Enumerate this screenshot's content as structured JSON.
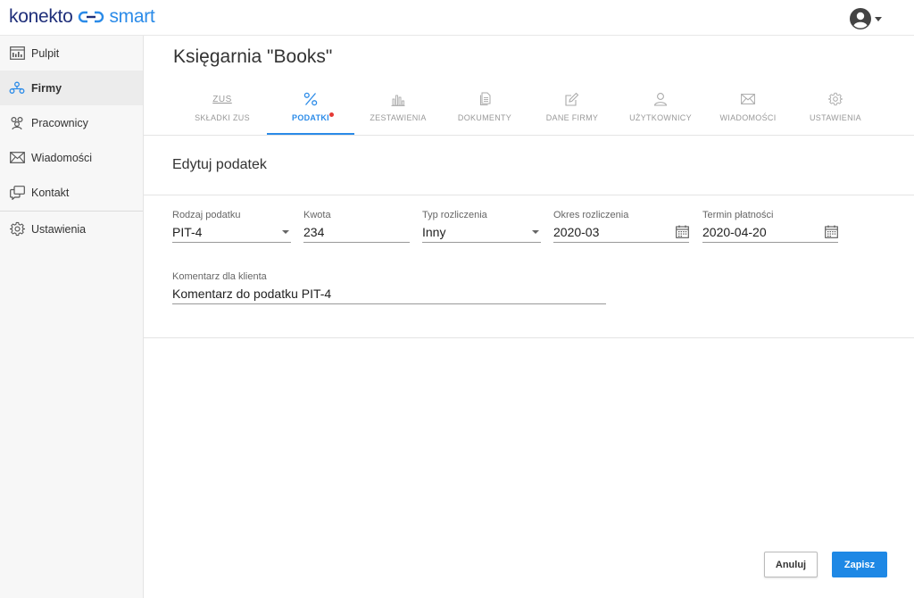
{
  "header": {
    "logo_left": "konekto",
    "logo_right": "smart"
  },
  "sidebar": {
    "items": [
      {
        "label": "Pulpit",
        "icon": "dashboard-icon"
      },
      {
        "label": "Firmy",
        "icon": "companies-icon",
        "active": true
      },
      {
        "label": "Pracownicy",
        "icon": "employees-icon"
      },
      {
        "label": "Wiadomości",
        "icon": "mail-icon"
      },
      {
        "label": "Kontakt",
        "icon": "contact-icon"
      },
      {
        "label": "Ustawienia",
        "icon": "gear-icon"
      }
    ]
  },
  "company": {
    "title": "Księgarnia \"Books\""
  },
  "tabs": [
    {
      "label": "SKŁADKI ZUS",
      "icon": "zus-icon"
    },
    {
      "label": "PODATKI",
      "icon": "percent-icon",
      "active": true,
      "badge": true
    },
    {
      "label": "ZESTAWIENIA",
      "icon": "bar-chart-icon"
    },
    {
      "label": "DOKUMENTY",
      "icon": "documents-icon"
    },
    {
      "label": "DANE FIRMY",
      "icon": "edit-icon"
    },
    {
      "label": "UŻYTKOWNICY",
      "icon": "user-icon"
    },
    {
      "label": "WIADOMOŚCI",
      "icon": "mail-icon"
    },
    {
      "label": "USTAWIENIA",
      "icon": "gear-icon"
    }
  ],
  "zus_icon_text": "ZUS",
  "form": {
    "title": "Edytuj podatek",
    "tax_type": {
      "label": "Rodzaj podatku",
      "value": "PIT-4"
    },
    "amount": {
      "label": "Kwota",
      "value": "234"
    },
    "settlement_type": {
      "label": "Typ rozliczenia",
      "value": "Inny"
    },
    "period": {
      "label": "Okres rozliczenia",
      "value": "2020-03"
    },
    "due_date": {
      "label": "Termin płatności",
      "value": "2020-04-20"
    },
    "comment": {
      "label": "Komentarz dla klienta",
      "value": "Komentarz do podatku PIT-4"
    }
  },
  "actions": {
    "cancel": "Anuluj",
    "save": "Zapisz"
  },
  "colors": {
    "accent": "#1e88e5",
    "brand_dark": "#1f2f7a",
    "badge": "#e53935"
  }
}
